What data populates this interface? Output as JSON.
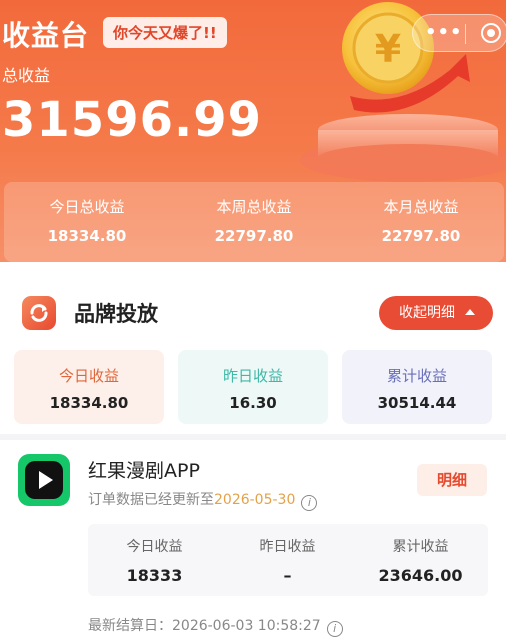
{
  "header": {
    "app_title": "收益台",
    "slogan": "你今天又爆了!!",
    "capsule_dots": "•••",
    "total_label": "总收益",
    "total_value": "31596.99",
    "stats": [
      {
        "label": "今日总收益",
        "value": "18334.80"
      },
      {
        "label": "本周总收益",
        "value": "22797.80"
      },
      {
        "label": "本月总收益",
        "value": "22797.80"
      }
    ]
  },
  "brand": {
    "title": "品牌投放",
    "collapse_label": "收起明细",
    "boxes": [
      {
        "label": "今日收益",
        "value": "18334.80",
        "label_color": "#e0663b",
        "bg": "#fdf0ea"
      },
      {
        "label": "昨日收益",
        "value": "16.30",
        "label_color": "#3fb8a6",
        "bg": "#eef8f7"
      },
      {
        "label": "累计收益",
        "value": "30514.44",
        "label_color": "#6a6fb8",
        "bg": "#f1f2fa"
      }
    ]
  },
  "app": {
    "name": "红果漫剧APP",
    "update_prefix": "订单数据已经更新至",
    "update_date": "2026-05-30",
    "detail_label": "明细",
    "stats": [
      {
        "label": "今日收益",
        "value": "18333"
      },
      {
        "label": "昨日收益",
        "value": "–"
      },
      {
        "label": "累计收益",
        "value": "23646.00"
      }
    ],
    "settle_text": "最新结算日：2026-06-03 10:58:27"
  },
  "icons": {
    "info": "i"
  }
}
